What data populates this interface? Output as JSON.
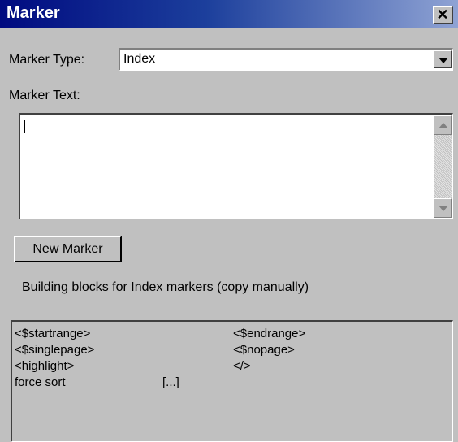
{
  "window": {
    "title": "Marker",
    "close_glyph": "✕"
  },
  "marker_type": {
    "label": "Marker Type:",
    "value": "Index"
  },
  "marker_text": {
    "label": "Marker Text:",
    "value": ""
  },
  "new_marker_button": "New Marker",
  "building_blocks_info": "Building blocks for Index markers (copy manually)",
  "building_blocks": [
    [
      "<$startrange>",
      "<$endrange>"
    ],
    [
      "<$singlepage>",
      "<$nopage>"
    ],
    [
      "<highlight>",
      "</>"
    ],
    [
      "force sort",
      "[...]"
    ]
  ]
}
